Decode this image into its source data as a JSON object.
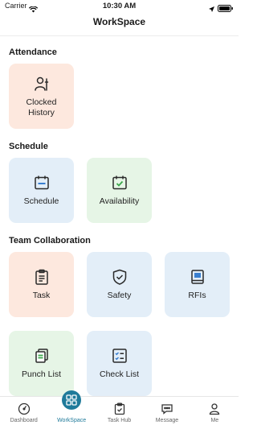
{
  "status_bar": {
    "carrier": "Carrier",
    "time": "10:30 AM"
  },
  "nav": {
    "title": "WorkSpace"
  },
  "sections": {
    "attendance": {
      "title": "Attendance",
      "items": [
        {
          "label": "Clocked\nHistory",
          "icon": "clocked-history-icon",
          "bg": "#fde8de"
        }
      ]
    },
    "schedule": {
      "title": "Schedule",
      "items": [
        {
          "label": "Schedule",
          "icon": "calendar-icon",
          "bg": "#e3eef8"
        },
        {
          "label": "Availability",
          "icon": "calendar-check-icon",
          "bg": "#e6f5e6"
        }
      ]
    },
    "team": {
      "title": "Team Collaboration",
      "items": [
        {
          "label": "Task",
          "icon": "clipboard-icon",
          "bg": "#fde8de"
        },
        {
          "label": "Safety",
          "icon": "shield-check-icon",
          "bg": "#e3eef8"
        },
        {
          "label": "RFIs",
          "icon": "book-icon",
          "bg": "#e3eef8"
        },
        {
          "label": "Punch List",
          "icon": "punch-list-icon",
          "bg": "#e6f5e6"
        },
        {
          "label": "Check List",
          "icon": "checklist-icon",
          "bg": "#e3eef8"
        }
      ]
    }
  },
  "tab_bar": {
    "tabs": [
      {
        "label": "Dashboard",
        "icon": "gauge-icon"
      },
      {
        "label": "WorkSpace",
        "icon": "grid-icon",
        "active": true
      },
      {
        "label": "Task Hub",
        "icon": "task-hub-icon"
      },
      {
        "label": "Message",
        "icon": "chat-icon"
      },
      {
        "label": "Me",
        "icon": "person-icon"
      }
    ]
  },
  "colors": {
    "accent": "#1f7a9a",
    "icon_stroke": "#2a2a2a",
    "peach": "#fde8de",
    "blue": "#e3eef8",
    "green": "#e6f5e6"
  }
}
